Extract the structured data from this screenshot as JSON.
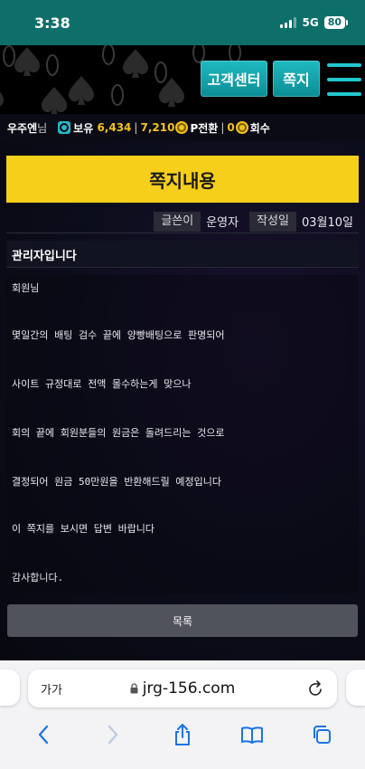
{
  "status": {
    "time": "3:38",
    "network": "5G",
    "battery": "80"
  },
  "header": {
    "cs_button": "고객센터",
    "message_button": "쪽지"
  },
  "user": {
    "name": "우주엔",
    "suffix": "님",
    "holding_label": "보유",
    "holding_value": "6,434",
    "points_value": "7,210",
    "convert_label": "P전환",
    "count_value": "0",
    "recover_label": "회수"
  },
  "page": {
    "title": "쪽지내용",
    "author_label": "글쓴이",
    "author_value": "운영자",
    "date_label": "작성일",
    "date_value": "03월10일",
    "message_title": "관리자입니다",
    "body_lines": [
      "회원님",
      "몇일간의 배팅 검수 끝에 양빵배팅으로 판명되어",
      "사이트 규정대로 전액 몰수하는게 맞으나",
      "회의 끝에 회원분들의 원금은 돌려드리는 것으로",
      "결정되어 원금 50만원을 반환해드릴 예정입니다",
      "이 쪽지를 보시면 답변 바랍니다",
      "감사합니다."
    ],
    "list_button": "목록"
  },
  "browser": {
    "text_size_label": "가가",
    "url": "jrg-156.com"
  },
  "colors": {
    "teal": "#0e6f6a",
    "accent": "#1fb9c0",
    "gold": "#f3c21a",
    "title_bar": "#f6cf1a"
  }
}
